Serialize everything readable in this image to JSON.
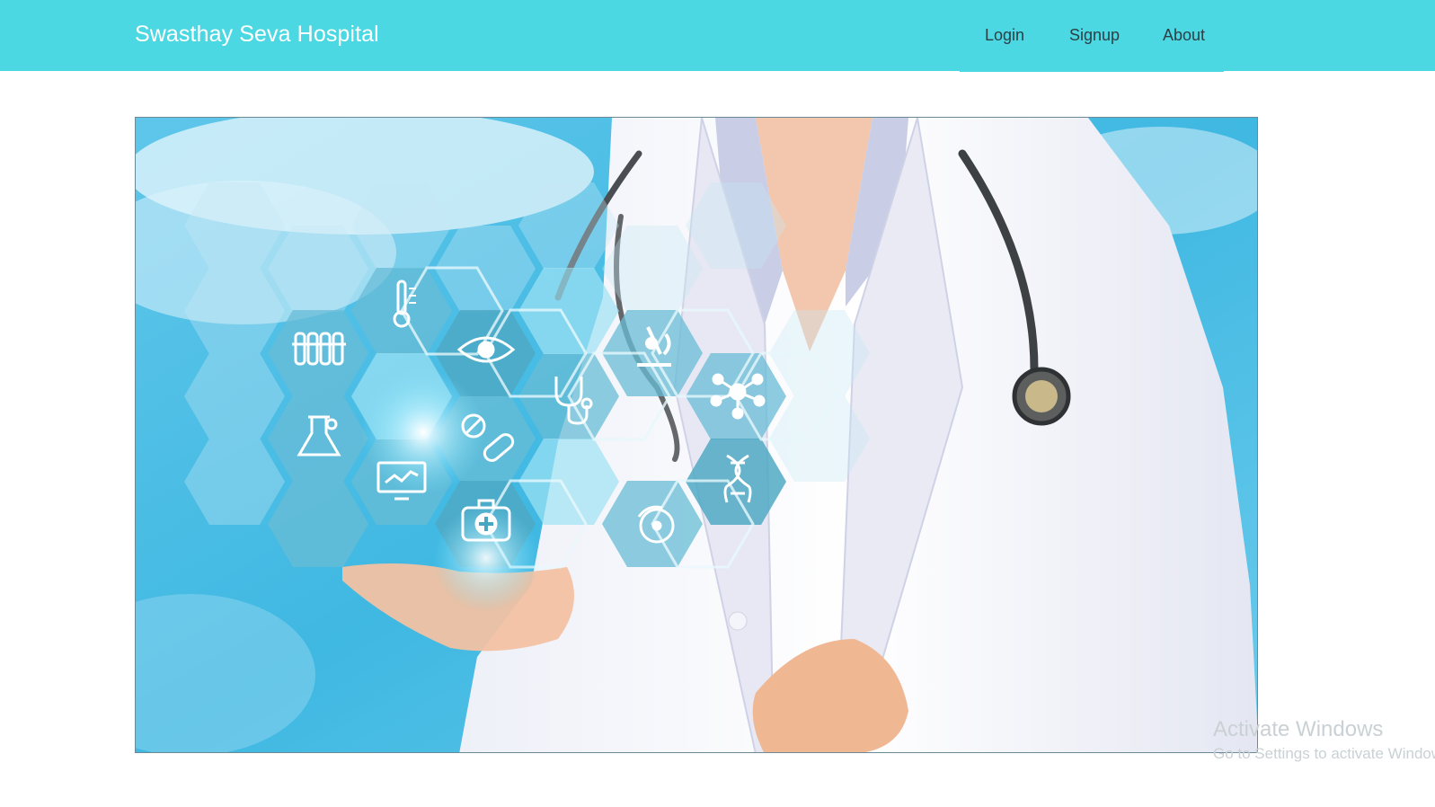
{
  "header": {
    "brand": "Swasthay Seva Hospital",
    "nav": [
      {
        "label": "Login"
      },
      {
        "label": "Signup"
      },
      {
        "label": "About"
      }
    ]
  },
  "hero": {
    "image": "doctor-with-medical-hexagon-icons",
    "icons": [
      "thermometer-icon",
      "test-tubes-icon",
      "eye-icon",
      "microscope-icon",
      "stethoscope-icon",
      "molecule-icon",
      "flask-icon",
      "pills-icon",
      "monitor-chart-icon",
      "dna-icon",
      "first-aid-kit-icon",
      "disc-icon"
    ]
  },
  "watermark": {
    "title": "Activate Windows",
    "subtitle": "Go to Settings to activate Windows."
  },
  "colors": {
    "navbar": "#4bd8e3",
    "brand_text": "#ffffff",
    "nav_text": "#2b3f45",
    "sky": "#5cc3e6"
  }
}
